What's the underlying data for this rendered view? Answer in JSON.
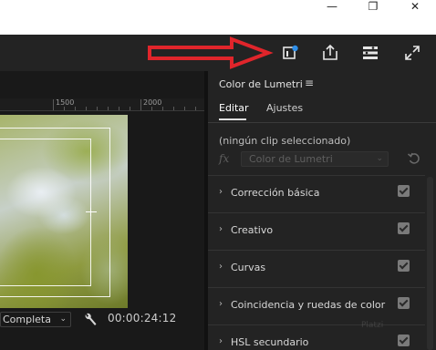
{
  "window": {
    "minimize_glyph": "—",
    "maximize_glyph": "❐",
    "close_glyph": "✕"
  },
  "toolbar": {
    "icons": [
      "color-panel-icon",
      "share-export-icon",
      "workspace-list-icon",
      "fullscreen-icon"
    ],
    "annotation_arrow_color": "#e0252b",
    "badge_color": "#2f8fe8"
  },
  "monitor": {
    "ruler_labels": [
      "1500",
      "2000"
    ],
    "resolution": "Completa",
    "timecode": "00:00:24:12"
  },
  "panel": {
    "title": "Color de Lumetri",
    "menu_glyph": "≡",
    "tabs": [
      {
        "label": "Editar",
        "active": true
      },
      {
        "label": "Ajustes",
        "active": false
      }
    ],
    "clip_status": "(ningún clip seleccionado)",
    "fx_label": "fx",
    "effect_name": "Color de Lumetri",
    "sections": [
      {
        "label": "Corrección básica",
        "checked": true
      },
      {
        "label": "Creativo",
        "checked": true
      },
      {
        "label": "Curvas",
        "checked": true
      },
      {
        "label": "Coincidencia y ruedas de color",
        "checked": true
      },
      {
        "label": "HSL secundario",
        "checked": true
      }
    ]
  },
  "watermark": "Platzi"
}
